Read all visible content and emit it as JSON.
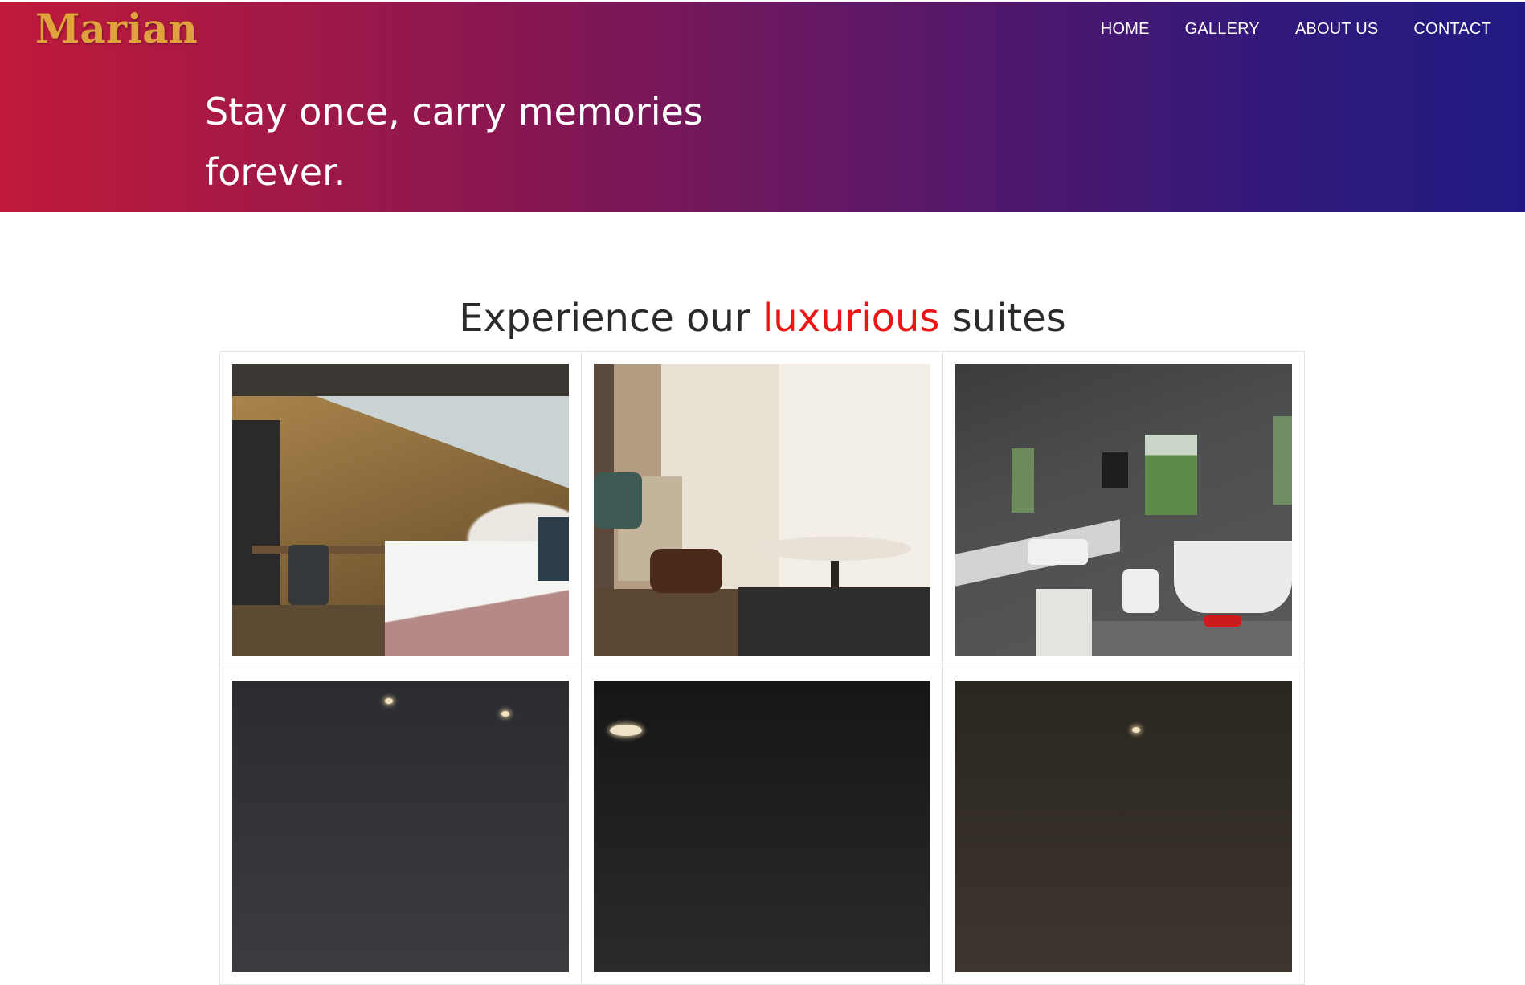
{
  "brand": {
    "logo_text": "Marian",
    "logo_color": "#e0a23c"
  },
  "nav": {
    "items": [
      {
        "label": "HOME"
      },
      {
        "label": "GALLERY"
      },
      {
        "label": "ABOUT US"
      },
      {
        "label": "CONTACT"
      }
    ]
  },
  "hero": {
    "tagline_line1": "Stay once, carry memories",
    "tagline_line2": "forever.",
    "gradient_colors": [
      "#c01a3a",
      "#861752",
      "#5a1868",
      "#34197a",
      "#1f1a82"
    ]
  },
  "suites": {
    "title_before": "Experience our ",
    "title_accent": "luxurious",
    "title_after": " suites",
    "accent_color": "#ea1515",
    "photos": [
      {
        "subject": "bedroom-with-desk-and-osb-wall"
      },
      {
        "subject": "lounge-with-sheer-curtains-and-round-table"
      },
      {
        "subject": "stone-bathroom-with-freestanding-tub"
      },
      {
        "subject": "dark-room-partial"
      },
      {
        "subject": "dark-room-with-pendant-partial"
      },
      {
        "subject": "warm-dark-room-partial"
      }
    ]
  }
}
